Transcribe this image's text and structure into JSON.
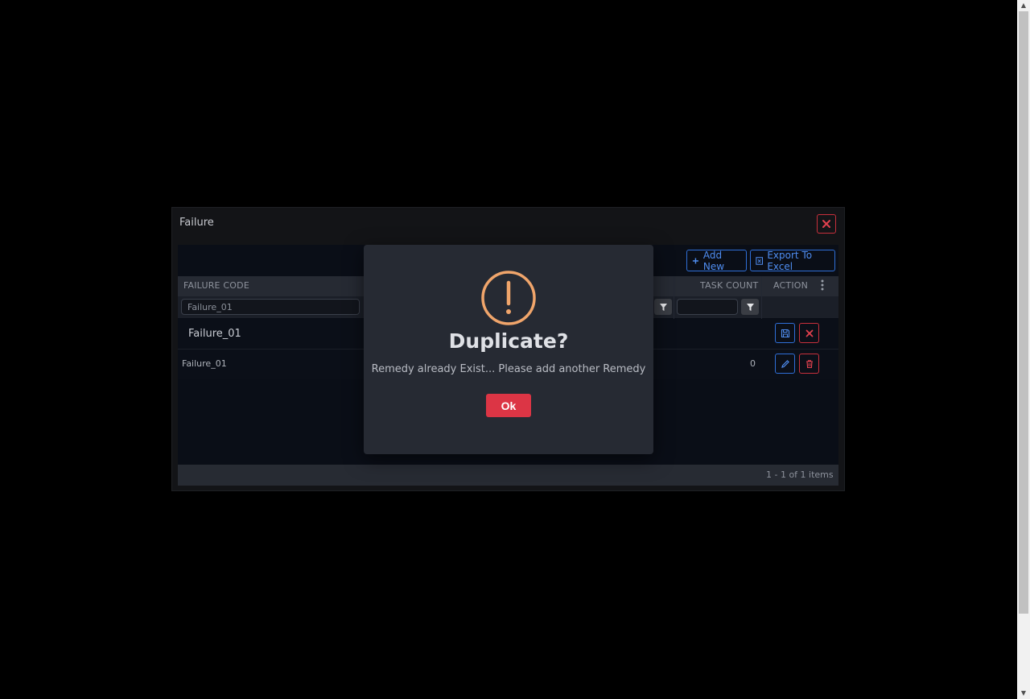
{
  "window": {
    "title": "Failure"
  },
  "toolbar": {
    "add_new_label": "Add New",
    "export_label": "Export To Excel"
  },
  "grid": {
    "columns": {
      "failure_code": "FAILURE CODE",
      "task_count": "TASK COUNT",
      "action": "ACTION"
    },
    "filters": {
      "failure_code_value": "Failure_01",
      "task_count_value": ""
    },
    "edit_row": {
      "failure_code": "Failure_01"
    },
    "rows": [
      {
        "failure_code": "Failure_01",
        "task_count": "0"
      }
    ],
    "pager_text": "1 - 1 of 1 items"
  },
  "modal": {
    "title": "Duplicate?",
    "message": "Remedy already Exist... Please add another Remedy",
    "ok_label": "Ok",
    "icon": "exclamation-circle-icon",
    "icon_color": "#f0a56b"
  },
  "colors": {
    "accent_blue": "#2f6fd8",
    "danger_red": "#dc3545",
    "background": "#000000"
  }
}
